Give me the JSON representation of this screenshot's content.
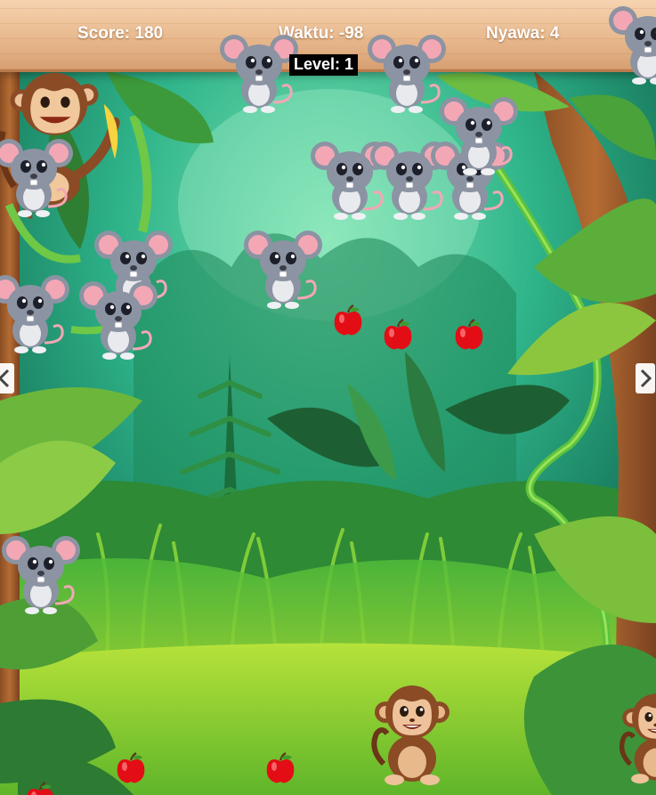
{
  "hud": {
    "score_label": "Score: 180",
    "time_label": "Waktu: -98",
    "lives_label": "Nyawa: 4",
    "level_label": "Level: 1"
  },
  "stats": {
    "score": 180,
    "time": -98,
    "lives": 4,
    "level": 1
  },
  "icons": {
    "mouse": "mouse-icon",
    "apple": "apple-icon",
    "monkey": "monkey-icon",
    "left": "left-arrow-icon",
    "right": "right-arrow-icon"
  },
  "colors": {
    "hud_wood": "#e8b98e",
    "text": "#ffffff",
    "level_bg": "#000000",
    "apple": "#e30d15",
    "mouse": "#8c93a2",
    "mouse_ear": "#f3a7b5",
    "monkey": "#8a4b25"
  }
}
